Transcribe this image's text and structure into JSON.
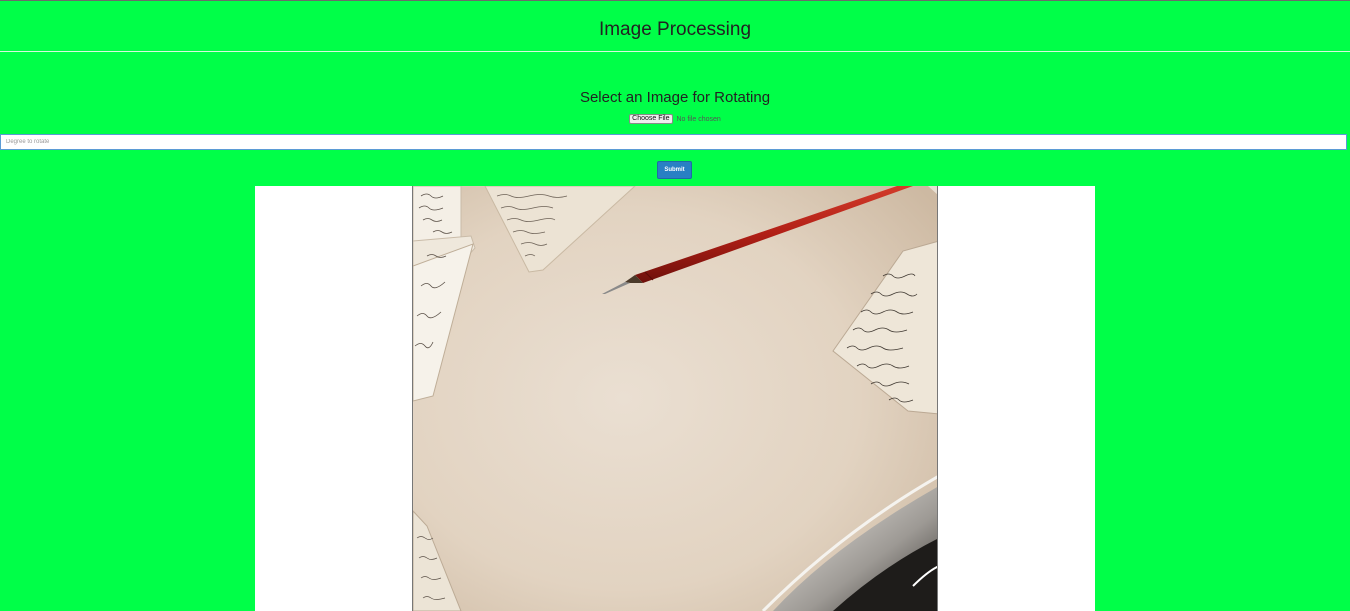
{
  "header": {
    "title": "Image Processing"
  },
  "form": {
    "select_title": "Select an Image for Rotating",
    "file_button_label": "Choose File",
    "file_status": "No file chosen",
    "degree_placeholder": "Degree to rotate",
    "degree_value": "",
    "submit_label": "Submit"
  },
  "result": {
    "image_description": "rotated-image-preview"
  },
  "colors": {
    "page_background": "#00ff48",
    "submit_button": "#2980c4",
    "panel_background": "#ffffff"
  }
}
